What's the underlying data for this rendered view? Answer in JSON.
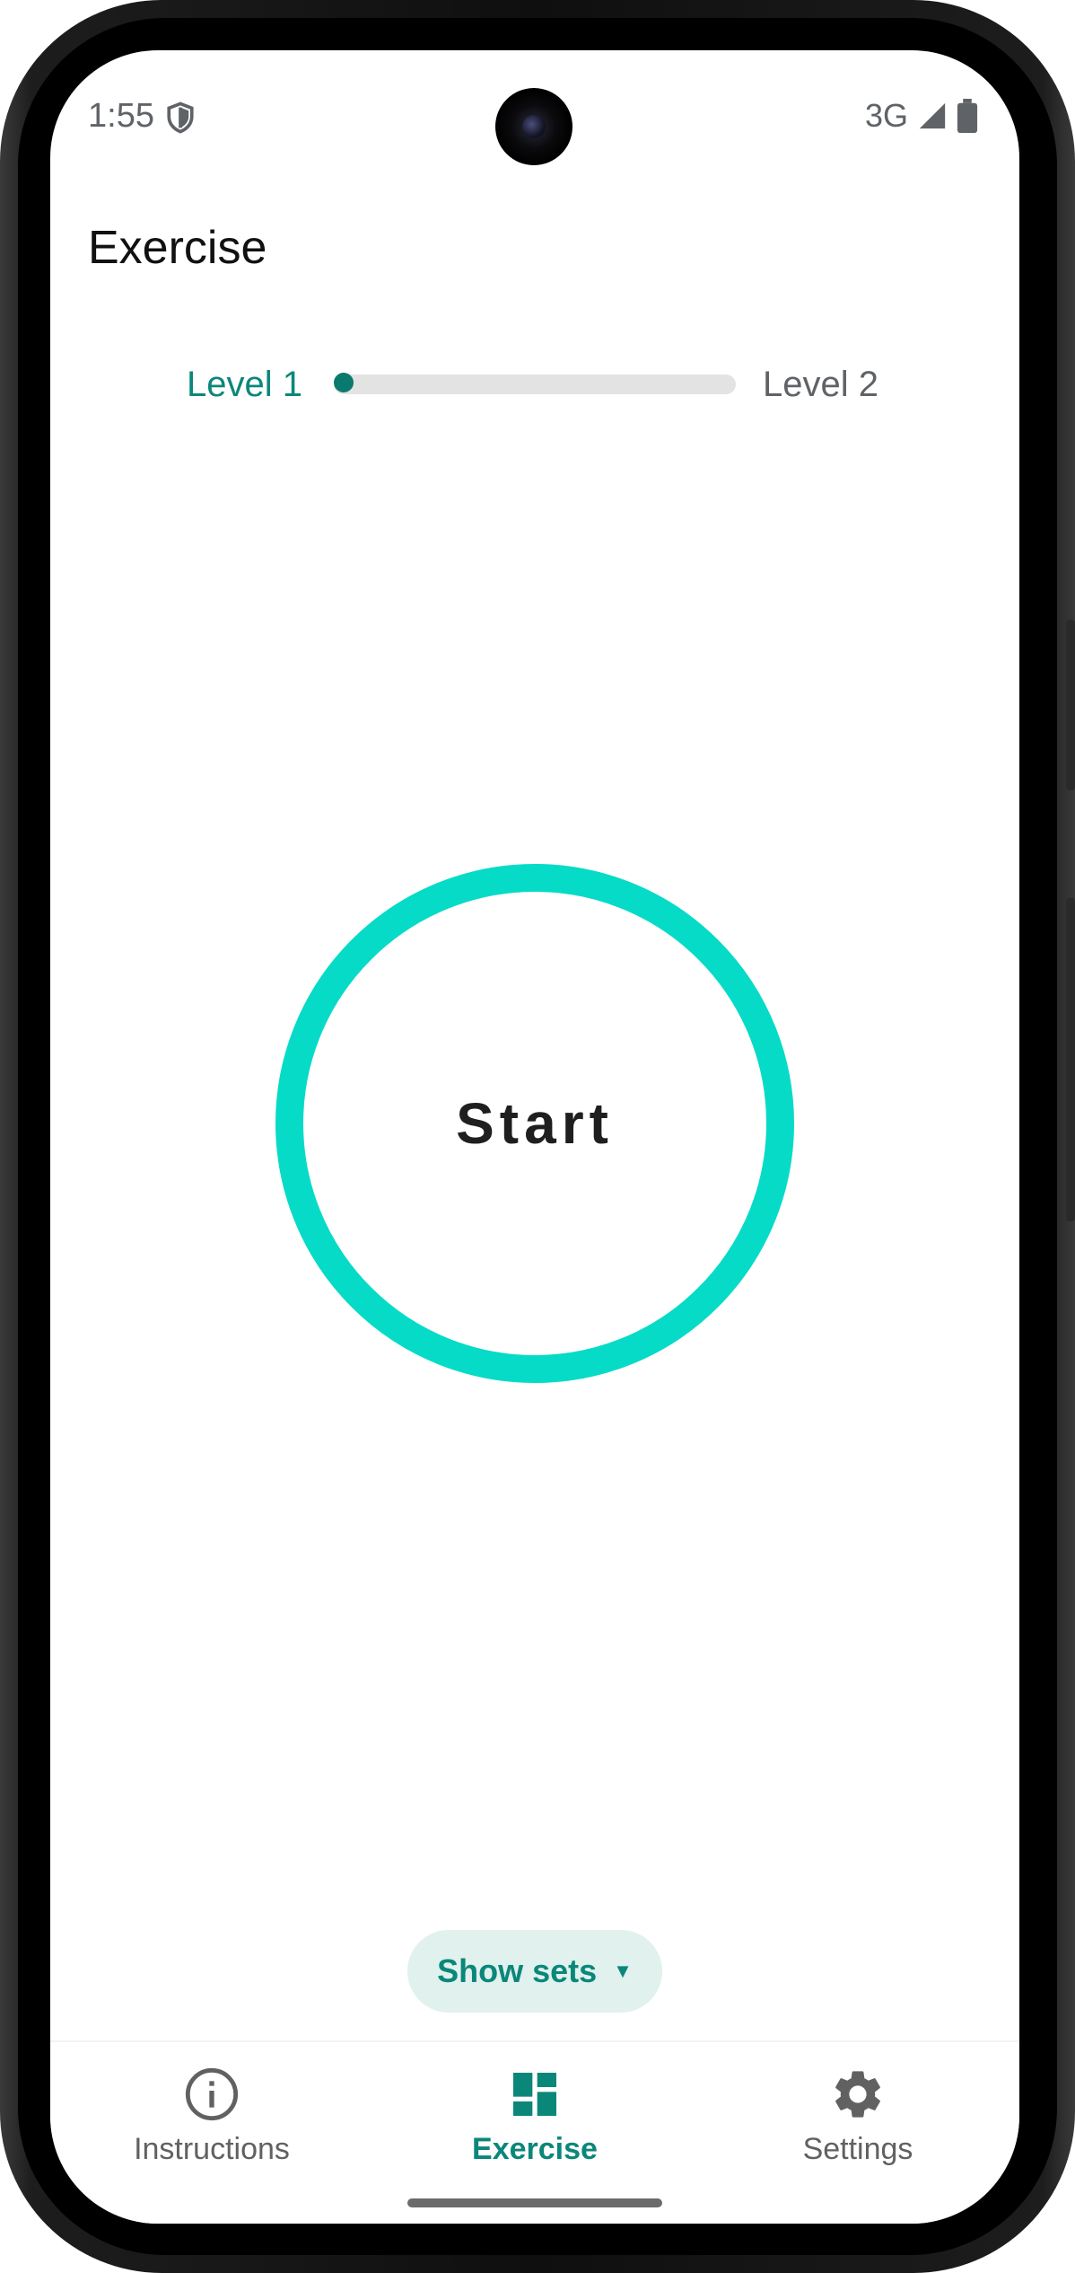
{
  "status_bar": {
    "time": "1:55",
    "network": "3G",
    "icons": [
      "shield-icon",
      "signal-icon",
      "battery-icon"
    ]
  },
  "app": {
    "title": "Exercise"
  },
  "level": {
    "current_label": "Level 1",
    "next_label": "Level 2",
    "progress": 0.0
  },
  "start_button": {
    "label": "Start"
  },
  "show_sets": {
    "label": "Show sets",
    "caret": "▼"
  },
  "bottom_nav": {
    "items": [
      {
        "label": "Instructions",
        "icon": "info-icon",
        "active": false
      },
      {
        "label": "Exercise",
        "icon": "dashboard-icon",
        "active": true
      },
      {
        "label": "Settings",
        "icon": "gear-icon",
        "active": false
      }
    ]
  },
  "colors": {
    "accent": "#0b877a",
    "ring": "#06dbc7",
    "pill_bg": "#e0f1ee",
    "inactive": "#616161"
  }
}
